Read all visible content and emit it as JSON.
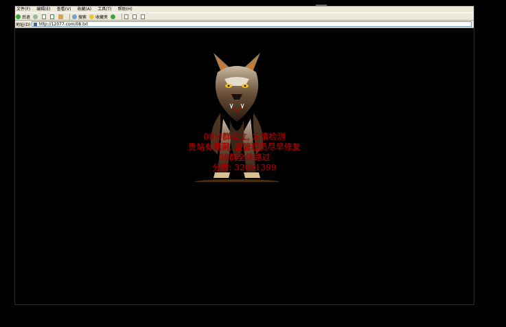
{
  "menubar": {
    "items": [
      "文件(F)",
      "编辑(E)",
      "查看(V)",
      "收藏(A)",
      "工具(T)",
      "帮助(H)"
    ]
  },
  "toolbar": {
    "back_label": "后退",
    "search_label": "搜索",
    "favorites_label": "收藏夹"
  },
  "addressbar": {
    "label": "地址(D)",
    "url": "http://12077.com/08.txt"
  },
  "page": {
    "lines": [
      "08分群成立, 友情检测",
      "贵站有漏洞, 望管理员尽早修复",
      "08群全体路过",
      "分群: 32091399"
    ]
  },
  "colors": {
    "message_text": "#b30000",
    "page_background": "#000000",
    "chrome": "#ece9d8"
  },
  "icons": [
    "back-icon",
    "forward-icon",
    "stop-icon",
    "refresh-icon",
    "home-icon",
    "search-icon",
    "favorites-icon",
    "history-icon",
    "mail-icon",
    "print-icon",
    "edit-icon",
    "page-icon",
    "wolf-image",
    "taskbar-app-icon"
  ]
}
